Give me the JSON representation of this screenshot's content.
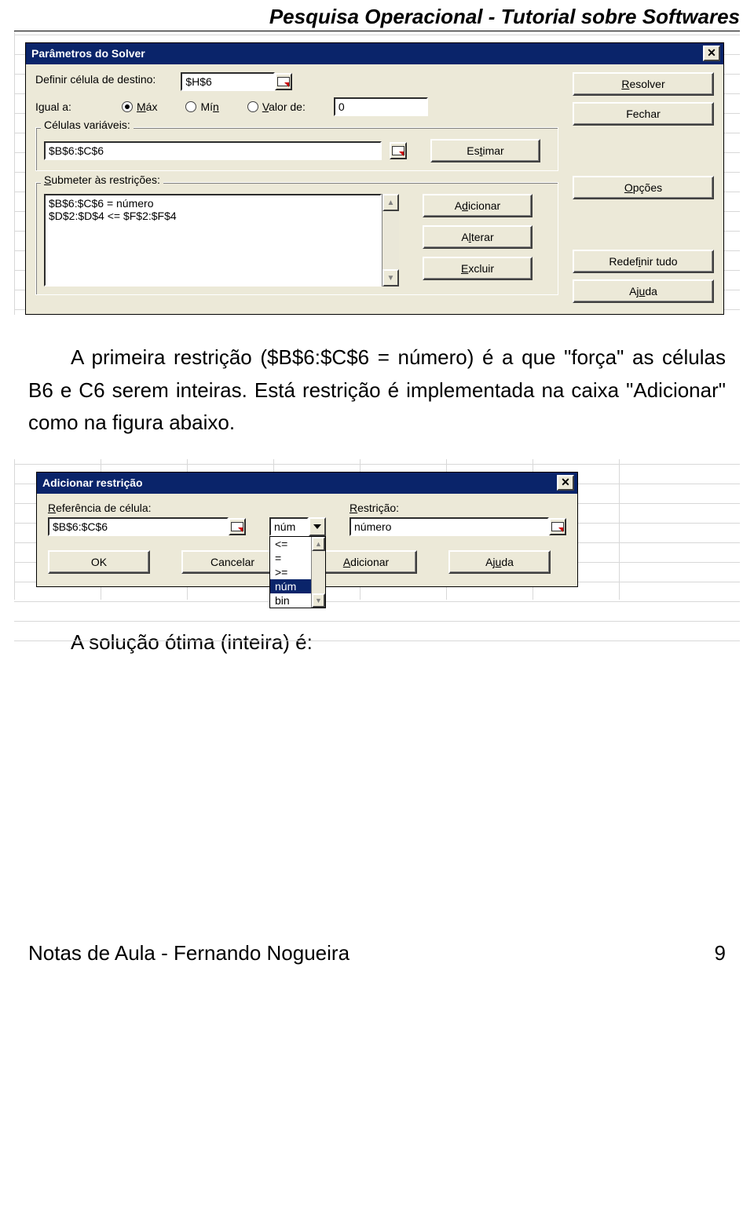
{
  "doc": {
    "header": "Pesquisa Operacional - Tutorial sobre Softwares",
    "para1": "A primeira restrição ($B$6:$C$6 = número)  é a que \"força\" as células B6 e C6 serem inteiras. Está restrição é implementada na caixa \"Adicionar\" como na figura abaixo.",
    "para2": "A solução ótima (inteira) é:",
    "footer_left": "Notas de Aula - Fernando Nogueira",
    "footer_right": "9"
  },
  "solver": {
    "title": "Parâmetros do Solver",
    "target_label": "Definir célula de destino:",
    "target_value": "$H$6",
    "equal_label": "Igual a:",
    "opt_max": "Máx",
    "opt_min": "Mín",
    "opt_valor": "Valor de:",
    "valor_value": "0",
    "vars_legend": "Células variáveis:",
    "vars_value": "$B$6:$C$6",
    "btn_estimar": "Estimar",
    "restr_legend": "Submeter às restrições:",
    "restr_line1": "$B$6:$C$6 = número",
    "restr_line2": "$D$2:$D$4 <= $F$2:$F$4",
    "btn_add": "Adicionar",
    "btn_alt": "Alterar",
    "btn_excl": "Excluir",
    "btn_resolver": "Resolver",
    "btn_fechar": "Fechar",
    "btn_opcoes": "Opções",
    "btn_redef": "Redefinir tudo",
    "btn_ajuda": "Ajuda"
  },
  "addc": {
    "title": "Adicionar restrição",
    "ref_label": "Referência de célula:",
    "ref_value": "$B$6:$C$6",
    "op_selected": "núm",
    "restr_label": "Restrição:",
    "restr_value": "número",
    "ops": [
      "<=",
      "=",
      ">=",
      "núm",
      "bin"
    ],
    "btn_ok": "OK",
    "btn_cancel": "Cancelar",
    "btn_add": "Adicionar",
    "btn_help": "Ajuda"
  }
}
